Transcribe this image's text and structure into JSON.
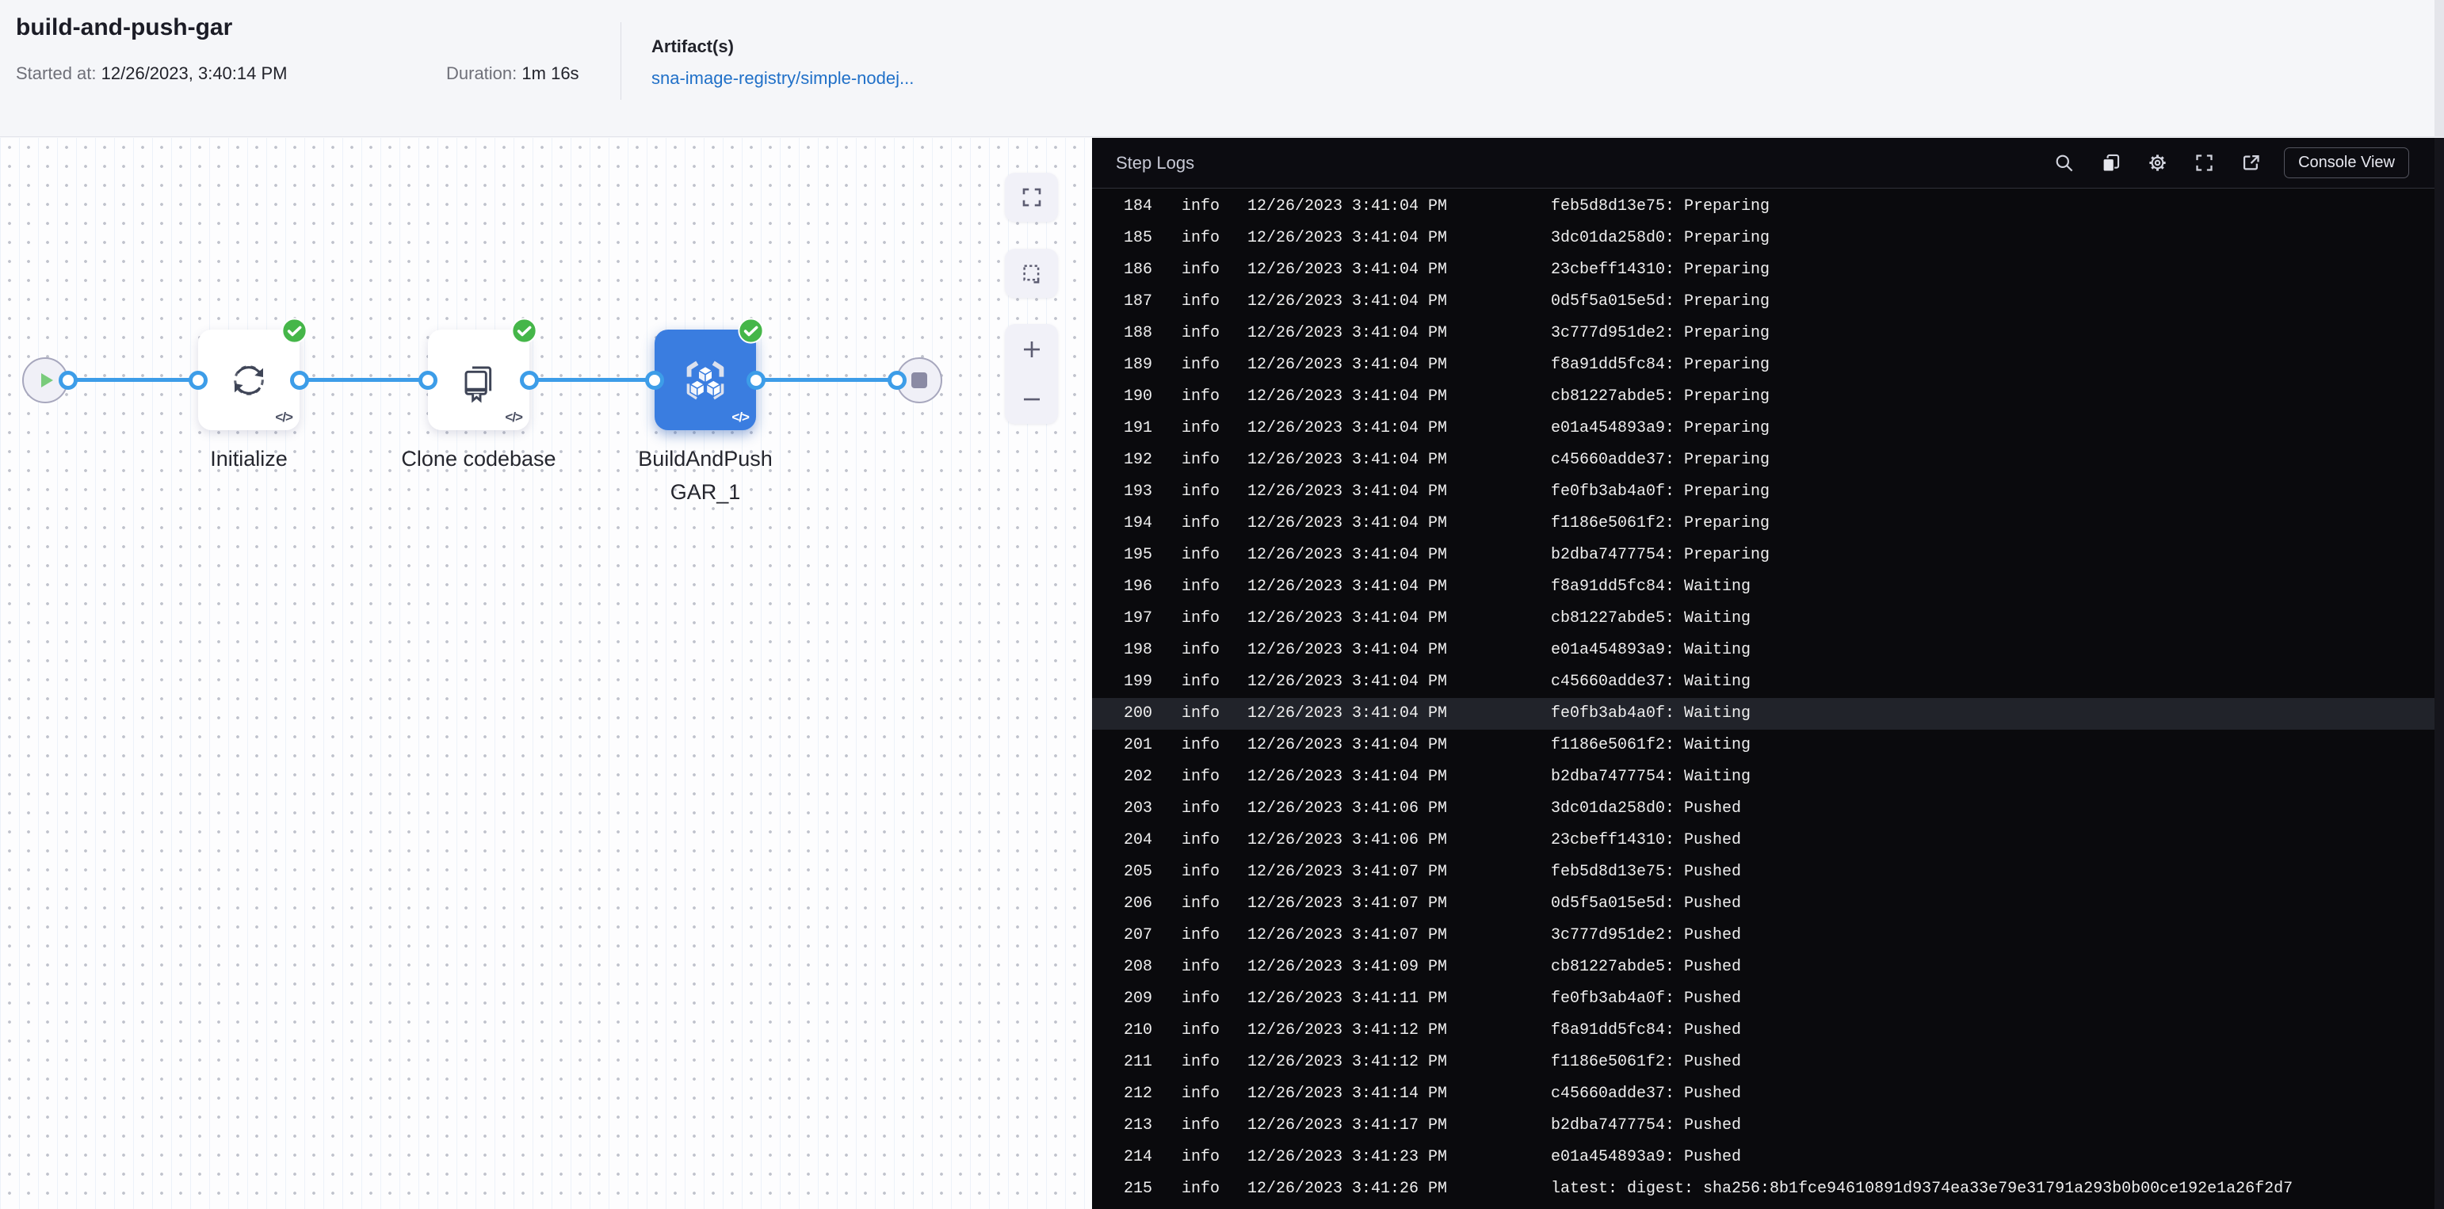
{
  "header": {
    "title": "build-and-push-gar",
    "started_label": "Started at:",
    "started_value": "12/26/2023, 3:40:14 PM",
    "duration_label": "Duration:",
    "duration_value": "1m 16s",
    "artifacts_label": "Artifact(s)",
    "artifact_link": "sna-image-registry/simple-nodej..."
  },
  "pipeline": {
    "start_node": "pipeline-start",
    "end_node": "pipeline-end",
    "nodes": [
      {
        "label": "Initialize",
        "status": "success",
        "selected": false
      },
      {
        "label": "Clone codebase",
        "status": "success",
        "selected": false
      },
      {
        "label": "BuildAndPushGAR_1",
        "status": "success",
        "selected": true
      }
    ],
    "code_glyph": "</>"
  },
  "canvas_controls": {
    "icons": [
      "fit-to-screen-icon",
      "marquee-select-icon",
      "zoom-in-icon",
      "zoom-out-icon"
    ]
  },
  "log_panel": {
    "title": "Step Logs",
    "toolbar_icons": [
      "search-icon",
      "copy-icon",
      "settings-gear-icon",
      "fullscreen-icon",
      "open-in-new-icon"
    ],
    "console_view_label": "Console View",
    "highlighted_line": 200,
    "lines": [
      {
        "n": 184,
        "level": "info",
        "time": "12/26/2023 3:41:04 PM",
        "msg": "feb5d8d13e75: Preparing",
        "partial": true
      },
      {
        "n": 185,
        "level": "info",
        "time": "12/26/2023 3:41:04 PM",
        "msg": "3dc01da258d0: Preparing"
      },
      {
        "n": 186,
        "level": "info",
        "time": "12/26/2023 3:41:04 PM",
        "msg": "23cbeff14310: Preparing"
      },
      {
        "n": 187,
        "level": "info",
        "time": "12/26/2023 3:41:04 PM",
        "msg": "0d5f5a015e5d: Preparing"
      },
      {
        "n": 188,
        "level": "info",
        "time": "12/26/2023 3:41:04 PM",
        "msg": "3c777d951de2: Preparing"
      },
      {
        "n": 189,
        "level": "info",
        "time": "12/26/2023 3:41:04 PM",
        "msg": "f8a91dd5fc84: Preparing"
      },
      {
        "n": 190,
        "level": "info",
        "time": "12/26/2023 3:41:04 PM",
        "msg": "cb81227abde5: Preparing"
      },
      {
        "n": 191,
        "level": "info",
        "time": "12/26/2023 3:41:04 PM",
        "msg": "e01a454893a9: Preparing"
      },
      {
        "n": 192,
        "level": "info",
        "time": "12/26/2023 3:41:04 PM",
        "msg": "c45660adde37: Preparing"
      },
      {
        "n": 193,
        "level": "info",
        "time": "12/26/2023 3:41:04 PM",
        "msg": "fe0fb3ab4a0f: Preparing"
      },
      {
        "n": 194,
        "level": "info",
        "time": "12/26/2023 3:41:04 PM",
        "msg": "f1186e5061f2: Preparing"
      },
      {
        "n": 195,
        "level": "info",
        "time": "12/26/2023 3:41:04 PM",
        "msg": "b2dba7477754: Preparing"
      },
      {
        "n": 196,
        "level": "info",
        "time": "12/26/2023 3:41:04 PM",
        "msg": "f8a91dd5fc84: Waiting"
      },
      {
        "n": 197,
        "level": "info",
        "time": "12/26/2023 3:41:04 PM",
        "msg": "cb81227abde5: Waiting"
      },
      {
        "n": 198,
        "level": "info",
        "time": "12/26/2023 3:41:04 PM",
        "msg": "e01a454893a9: Waiting"
      },
      {
        "n": 199,
        "level": "info",
        "time": "12/26/2023 3:41:04 PM",
        "msg": "c45660adde37: Waiting"
      },
      {
        "n": 200,
        "level": "info",
        "time": "12/26/2023 3:41:04 PM",
        "msg": "fe0fb3ab4a0f: Waiting",
        "highlight": true
      },
      {
        "n": 201,
        "level": "info",
        "time": "12/26/2023 3:41:04 PM",
        "msg": "f1186e5061f2: Waiting"
      },
      {
        "n": 202,
        "level": "info",
        "time": "12/26/2023 3:41:04 PM",
        "msg": "b2dba7477754: Waiting"
      },
      {
        "n": 203,
        "level": "info",
        "time": "12/26/2023 3:41:06 PM",
        "msg": "3dc01da258d0: Pushed"
      },
      {
        "n": 204,
        "level": "info",
        "time": "12/26/2023 3:41:06 PM",
        "msg": "23cbeff14310: Pushed"
      },
      {
        "n": 205,
        "level": "info",
        "time": "12/26/2023 3:41:07 PM",
        "msg": "feb5d8d13e75: Pushed"
      },
      {
        "n": 206,
        "level": "info",
        "time": "12/26/2023 3:41:07 PM",
        "msg": "0d5f5a015e5d: Pushed"
      },
      {
        "n": 207,
        "level": "info",
        "time": "12/26/2023 3:41:07 PM",
        "msg": "3c777d951de2: Pushed"
      },
      {
        "n": 208,
        "level": "info",
        "time": "12/26/2023 3:41:09 PM",
        "msg": "cb81227abde5: Pushed"
      },
      {
        "n": 209,
        "level": "info",
        "time": "12/26/2023 3:41:11 PM",
        "msg": "fe0fb3ab4a0f: Pushed"
      },
      {
        "n": 210,
        "level": "info",
        "time": "12/26/2023 3:41:12 PM",
        "msg": "f8a91dd5fc84: Pushed"
      },
      {
        "n": 211,
        "level": "info",
        "time": "12/26/2023 3:41:12 PM",
        "msg": "f1186e5061f2: Pushed"
      },
      {
        "n": 212,
        "level": "info",
        "time": "12/26/2023 3:41:14 PM",
        "msg": "c45660adde37: Pushed"
      },
      {
        "n": 213,
        "level": "info",
        "time": "12/26/2023 3:41:17 PM",
        "msg": "b2dba7477754: Pushed"
      },
      {
        "n": 214,
        "level": "info",
        "time": "12/26/2023 3:41:23 PM",
        "msg": "e01a454893a9: Pushed"
      },
      {
        "n": 215,
        "level": "info",
        "time": "12/26/2023 3:41:26 PM",
        "msg": "latest: digest: sha256:8b1fce94610891d9374ea33e79e31791a293b0b00ce192e1a26f2d7"
      }
    ]
  },
  "colors": {
    "accent_blue": "#3d9de8",
    "selected_node_blue": "#3a7de0",
    "success_green": "#45b649",
    "play_green": "#79cb7b",
    "link_blue": "#2070c8",
    "log_background": "#0a0a0d",
    "header_background": "#f5f6f9"
  }
}
